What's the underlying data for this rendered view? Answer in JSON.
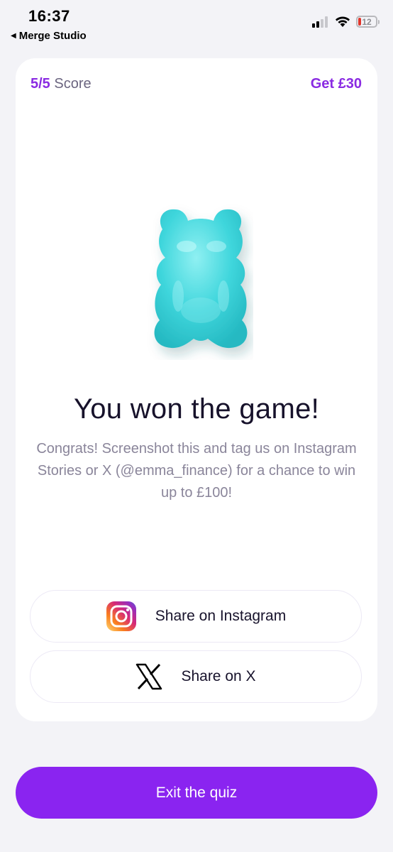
{
  "status_bar": {
    "time": "16:37",
    "back_app": "Merge Studio",
    "battery_level": "12"
  },
  "header": {
    "score_value": "5/5",
    "score_label": "Score",
    "offer_label": "Get £30"
  },
  "result": {
    "title": "You won the game!",
    "description": "Congrats! Screenshot this and tag us on Instagram Stories or X (@emma_finance) for a chance to win up to £100!"
  },
  "share": {
    "instagram_label": "Share on Instagram",
    "x_label": "Share on X"
  },
  "footer": {
    "exit_label": "Exit the quiz"
  },
  "colors": {
    "accent": "#8a24f0",
    "bear": "#3fd6dc"
  }
}
